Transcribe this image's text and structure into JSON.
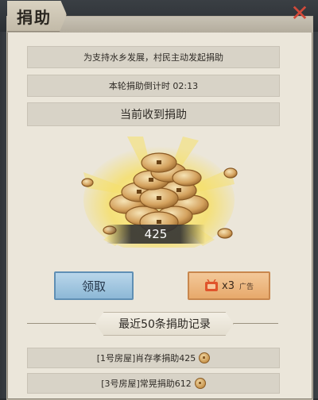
{
  "title": "捐助",
  "close_icon": "close-x-icon",
  "colors": {
    "accent_blue": "#8db8d6",
    "accent_orange": "#e7a96b",
    "close_red": "#d24a3a"
  },
  "info": {
    "description": "为支持水乡发展，村民主动发起捐助",
    "countdown": "本轮捐助倒计时 02:13",
    "received_header": "当前收到捐助"
  },
  "amount": "425",
  "buttons": {
    "claim": "领取",
    "ad_multiplier": "x3",
    "ad_label": "广告",
    "ad_icon": "tv-icon"
  },
  "records": {
    "header": "最近50条捐助记录",
    "items": [
      {
        "text": "[1号房屋]肖存孝捐助425"
      },
      {
        "text": "[3号房屋]常晃捐助612"
      }
    ]
  }
}
